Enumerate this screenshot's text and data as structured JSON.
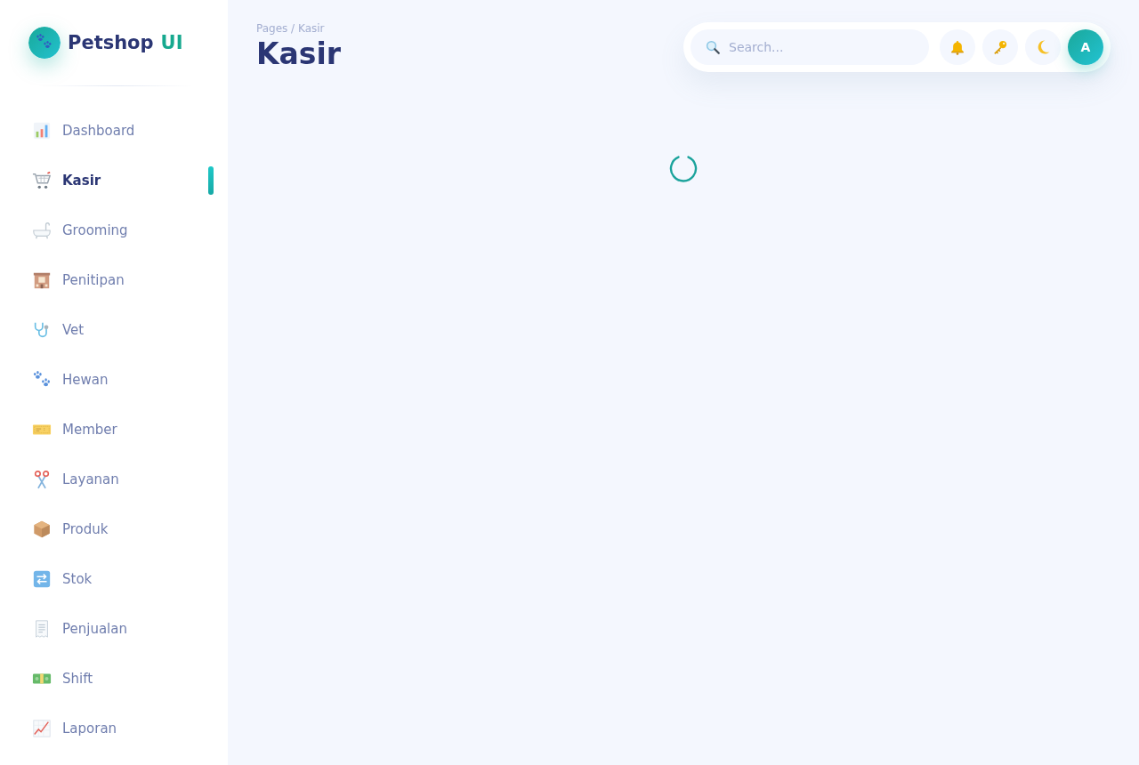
{
  "sidebar": {
    "brand": {
      "name": "Petshop",
      "accent": "UI"
    },
    "items": [
      {
        "label": "Dashboard",
        "selected": false
      },
      {
        "label": "Kasir",
        "selected": true
      },
      {
        "label": "Grooming",
        "selected": false
      },
      {
        "label": "Penitipan",
        "selected": false
      },
      {
        "label": "Vet",
        "selected": false
      },
      {
        "label": "Hewan",
        "selected": false
      },
      {
        "label": "Member",
        "selected": false
      },
      {
        "label": "Layanan",
        "selected": false
      },
      {
        "label": "Produk",
        "selected": false
      },
      {
        "label": "Stok",
        "selected": false
      },
      {
        "label": "Penjualan",
        "selected": false
      },
      {
        "label": "Shift",
        "selected": false
      },
      {
        "label": "Laporan",
        "selected": false
      }
    ]
  },
  "header": {
    "breadcrumb": "Pages / Kasir",
    "title": "Kasir"
  },
  "toolbar": {
    "search": {
      "placeholder": "Search..."
    },
    "avatar": {
      "initial": "A"
    }
  },
  "content": {
    "loading": true
  }
}
